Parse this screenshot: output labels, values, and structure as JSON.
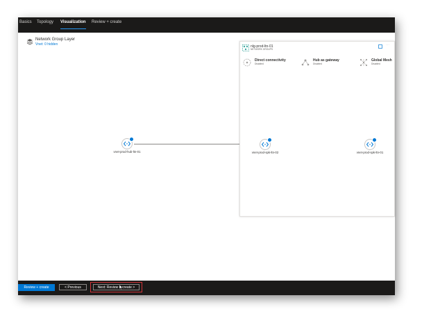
{
  "tabs": [
    {
      "label": "Basics",
      "active": false
    },
    {
      "label": "Topology",
      "active": false
    },
    {
      "label": "Visualization",
      "active": true
    },
    {
      "label": "Review + create",
      "active": false
    }
  ],
  "layer": {
    "icon": "layers-icon",
    "title": "Network Group Layer",
    "link": "Vnet: 0 hidden"
  },
  "hub_vnet": {
    "name": "vnet-prod-hub-ltn-01",
    "icon": "vnet-icon"
  },
  "network_group": {
    "name": "nlg-prod-ltn-01",
    "type": "NETWORK GROUPS",
    "icon": "network-group-icon",
    "connectivity": [
      {
        "label": "Direct connectivity",
        "state": "Disabled",
        "icon": "direct-connectivity-icon"
      },
      {
        "label": "Hub as gateway",
        "state": "Disabled",
        "icon": "hub-gateway-icon"
      },
      {
        "label": "Global Mesh",
        "state": "Disabled",
        "icon": "global-mesh-icon"
      }
    ],
    "members": [
      {
        "name": "vnet-prod-spk-ltn-02",
        "icon": "vnet-icon"
      },
      {
        "name": "vnet-prod-spk-ltn-01",
        "icon": "vnet-icon"
      }
    ]
  },
  "footer": {
    "review_create": "Review + create",
    "previous": "< Previous",
    "next": "Next: Review + create >"
  },
  "colors": {
    "accent": "#0078d4",
    "highlight": "#d13438",
    "bar": "#1b1a19"
  }
}
